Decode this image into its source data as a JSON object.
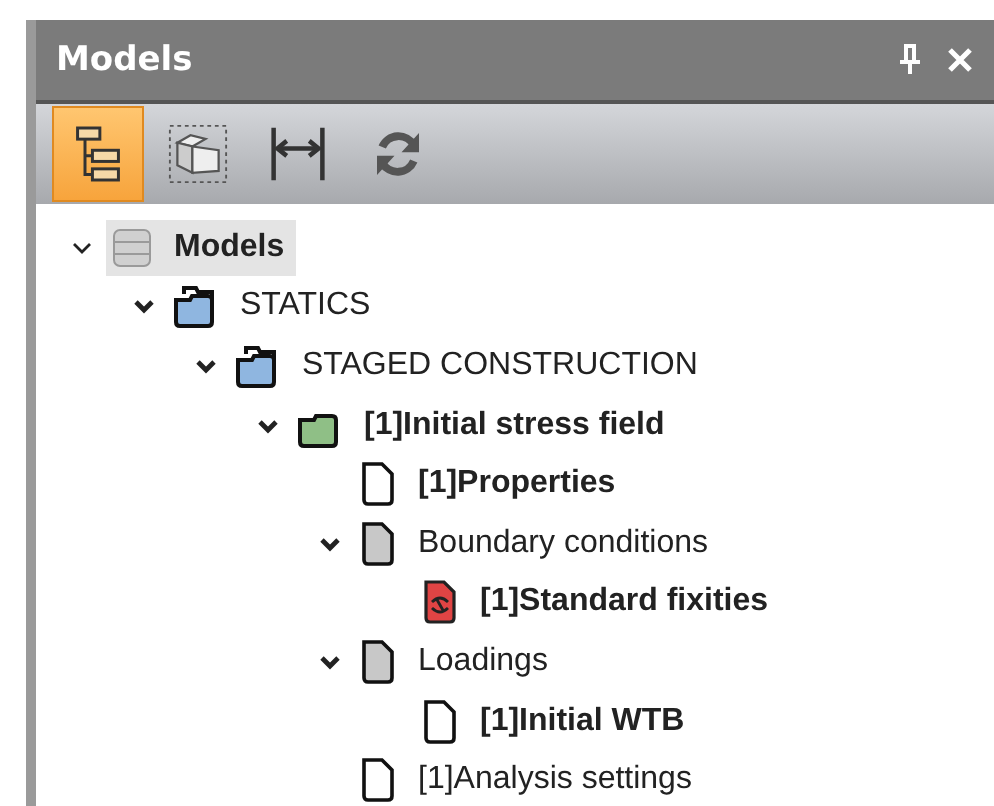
{
  "window": {
    "title": "Models"
  },
  "toolbar": [
    {
      "kind": "tree",
      "selected": true
    },
    {
      "kind": "model",
      "selected": false
    },
    {
      "kind": "measure",
      "selected": false
    },
    {
      "kind": "refresh",
      "selected": false
    }
  ],
  "tree": [
    {
      "label": "Models",
      "kind": "database",
      "bold": true,
      "selected": true,
      "expanded": true,
      "children": [
        {
          "label": "STATICS",
          "kind": "folder",
          "bold": false,
          "selected": false,
          "expanded": true,
          "children": [
            {
              "label": "STAGED CONSTRUCTION",
              "kind": "folder",
              "bold": false,
              "selected": false,
              "expanded": true,
              "children": [
                {
                  "label": "[1]Initial stress field",
                  "kind": "stage",
                  "bold": true,
                  "selected": false,
                  "expanded": true,
                  "children": [
                    {
                      "label": "[1]Properties",
                      "kind": "file",
                      "bold": true,
                      "selected": false
                    },
                    {
                      "label": "Boundary conditions",
                      "kind": "group",
                      "bold": false,
                      "selected": false,
                      "expanded": true,
                      "children": [
                        {
                          "label": "[1]Standard fixities",
                          "kind": "fixity",
                          "bold": true,
                          "selected": false
                        }
                      ]
                    },
                    {
                      "label": "Loadings",
                      "kind": "group",
                      "bold": false,
                      "selected": false,
                      "expanded": true,
                      "children": [
                        {
                          "label": "[1]Initial WTB",
                          "kind": "file",
                          "bold": true,
                          "selected": false
                        }
                      ]
                    },
                    {
                      "label": "[1]Analysis settings",
                      "kind": "file",
                      "bold": false,
                      "selected": false
                    }
                  ]
                }
              ]
            }
          ]
        }
      ]
    }
  ]
}
